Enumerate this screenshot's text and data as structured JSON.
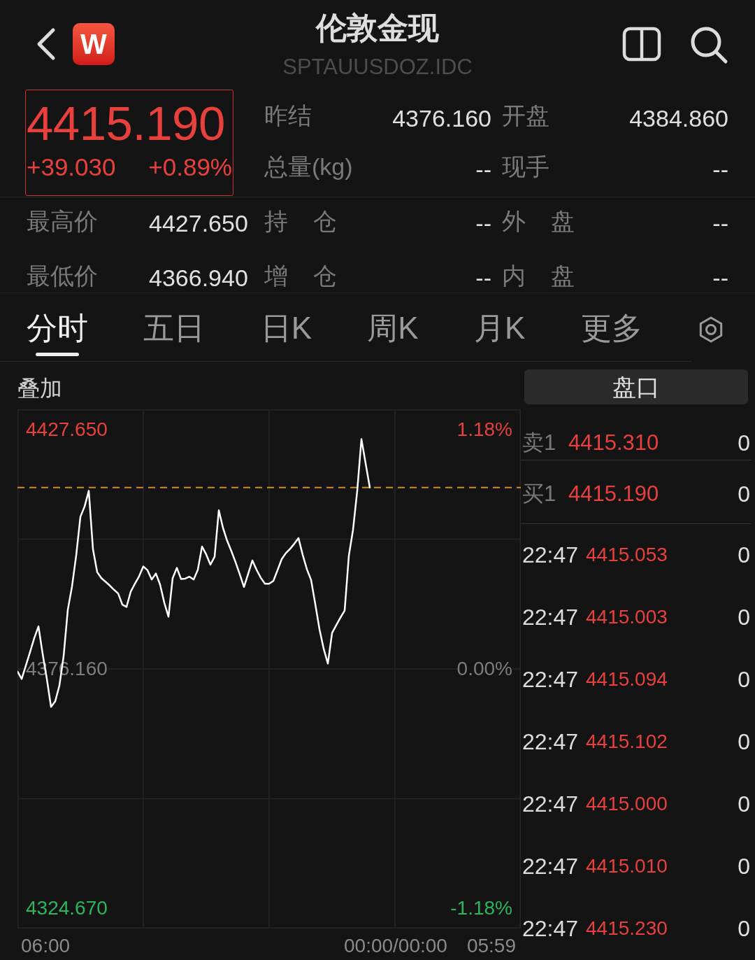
{
  "header": {
    "logo_text": "W",
    "title": "伦敦金现",
    "code": "SPTAUUSDOZ.IDC"
  },
  "quote": {
    "price": "4415.190",
    "change": "+39.030",
    "change_percent": "+0.89%",
    "rising": true
  },
  "summary": [
    {
      "cells": [
        "昨结",
        "4376.160",
        "开盘",
        "4384.860"
      ]
    },
    {
      "cells": [
        "总量(kg)",
        "--",
        "现手",
        "--"
      ]
    }
  ],
  "stats": [
    {
      "cells": [
        "最高价",
        "4427.650",
        "持 仓",
        "--",
        "外 盘",
        "--"
      ]
    },
    {
      "cells": [
        "最低价",
        "4366.940",
        "增 仓",
        "--",
        "内 盘",
        "--"
      ]
    }
  ],
  "tabs": [
    {
      "label": "分时",
      "selected": true
    },
    {
      "label": "五日",
      "selected": false
    },
    {
      "label": "日K",
      "selected": false
    },
    {
      "label": "周K",
      "selected": false
    },
    {
      "label": "月K",
      "selected": false
    },
    {
      "label": "更多",
      "selected": false
    }
  ],
  "chart": {
    "overlay_label": "叠加",
    "percent_labels": [
      "1.18%",
      "0.00%",
      "-1.18%"
    ],
    "time_start": "06:00",
    "time_readout": "00:00/00:00",
    "time_end": "05:59",
    "chart_data": {
      "type": "line",
      "categories": [
        null,
        null,
        null,
        null,
        null,
        null,
        null,
        null,
        null,
        null,
        null,
        null,
        null,
        null,
        null,
        null,
        null,
        null,
        null,
        null,
        null,
        null,
        null,
        null,
        null,
        null,
        null,
        null,
        null,
        null,
        null,
        null,
        null,
        null,
        null,
        null,
        null,
        null,
        null,
        null,
        null,
        null,
        null,
        null,
        null,
        null,
        null,
        null,
        null,
        null,
        null,
        null,
        null,
        null,
        null,
        null,
        null,
        null,
        null,
        null,
        null,
        null,
        null,
        null,
        null,
        null,
        null,
        null,
        null,
        null,
        null,
        null,
        null,
        null,
        null,
        null,
        null,
        null,
        null,
        null,
        null,
        null,
        null,
        null,
        null,
        null,
        null,
        null,
        null,
        null,
        null,
        null,
        null,
        null,
        null,
        null,
        null,
        null,
        null,
        null,
        null,
        null,
        null,
        null,
        null,
        null,
        null,
        null,
        null,
        null,
        null,
        null,
        null,
        null,
        null,
        null,
        null,
        null,
        null,
        null,
        null
      ],
      "series": [
        {
          "color": "#ffffff",
          "values": [
            4375.6,
            4374.0,
            4376.9,
            4379.8,
            4382.8,
            4385.3,
            4379.4,
            4374.0,
            4368.0,
            4369.2,
            4372.6,
            4378.9,
            4388.9,
            4393.9,
            4400.6,
            4408.9,
            4411.1,
            4414.5,
            4401.9,
            4397.0,
            4395.7,
            4394.9,
            4394.1,
            4393.2,
            4392.4,
            4390.0,
            4389.5,
            4392.8,
            4394.5,
            4396.1,
            4398.2,
            4397.4,
            4395.4,
            4396.7,
            4394.3,
            4390.4,
            4387.4,
            4395.7,
            4397.9,
            4395.5,
            4395.6,
            4396.0,
            4395.4,
            4397.5,
            4402.5,
            4400.8,
            4398.6,
            4400.3,
            4410.3,
            4406.5,
            4403.7,
            4401.5,
            4399.1,
            4396.5,
            4393.8,
            4396.6,
            4399.5,
            4397.5,
            4395.8,
            4394.5,
            4394.5,
            4395.1,
            4397.4,
            4399.8,
            4401.1,
            4402.0,
            4403.1,
            4404.3,
            4400.7,
            4397.6,
            4395.3,
            4390.1,
            4384.7,
            4380.5,
            4377.3,
            4383.9,
            4385.6,
            4387.2,
            4388.7,
            4400.5,
            4406.1,
            4414.5,
            4425.6,
            4420.4,
            4415.2,
            null,
            null,
            null,
            null,
            null,
            null,
            null,
            null,
            null,
            null,
            null,
            null,
            null,
            null,
            null,
            null,
            null,
            null,
            null,
            null,
            null,
            null,
            null,
            null,
            null,
            null,
            null,
            null,
            null,
            null,
            null,
            null,
            null,
            null,
            null,
            null
          ]
        }
      ],
      "ylim": [
        4320.3,
        4432.02
      ],
      "yticks": [
        {
          "value": 4324.67,
          "label": "4324.670"
        },
        {
          "value": 4376.16,
          "label": "4376.160"
        },
        {
          "value": 4427.65,
          "label": "4427.650"
        }
      ],
      "grid": true,
      "ref_lines": [
        {
          "axis": "y",
          "value": 4415.19
        }
      ]
    }
  },
  "order_book": {
    "title": "盘口",
    "levels": [
      {
        "side": "卖1",
        "price": "4415.310",
        "volume": "0",
        "rising": true
      },
      {
        "side": "买1",
        "price": "4415.190",
        "volume": "0",
        "rising": true
      }
    ],
    "trades": [
      {
        "time": "22:47",
        "price": "4415.053",
        "volume": "0",
        "rising": true
      },
      {
        "time": "22:47",
        "price": "4415.003",
        "volume": "0",
        "rising": true
      },
      {
        "time": "22:47",
        "price": "4415.094",
        "volume": "0",
        "rising": true
      },
      {
        "time": "22:47",
        "price": "4415.102",
        "volume": "0",
        "rising": true
      },
      {
        "time": "22:47",
        "price": "4415.000",
        "volume": "0",
        "rising": true
      },
      {
        "time": "22:47",
        "price": "4415.010",
        "volume": "0",
        "rising": true
      },
      {
        "time": "22:47",
        "price": "4415.230",
        "volume": "0",
        "rising": true
      }
    ]
  }
}
